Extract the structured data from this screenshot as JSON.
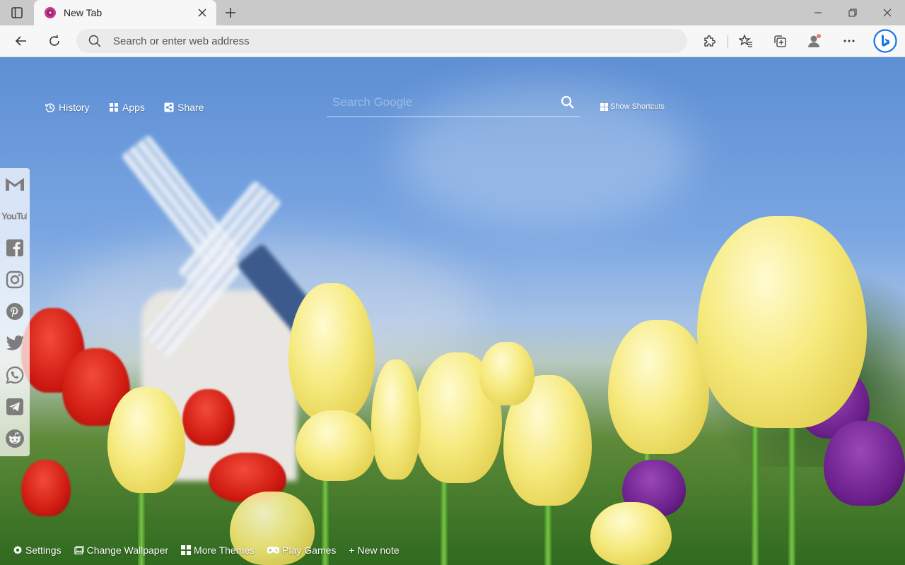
{
  "browser": {
    "tab_title": "New Tab",
    "address_placeholder": "Search or enter web address"
  },
  "newtab": {
    "links": {
      "history": "History",
      "apps": "Apps",
      "share": "Share"
    },
    "search_placeholder": "Search Google",
    "show_shortcuts": "Show Shortcuts",
    "social_icons": [
      "gmail-icon",
      "youtube-icon",
      "facebook-icon",
      "instagram-icon",
      "pinterest-icon",
      "twitter-icon",
      "whatsapp-icon",
      "telegram-icon",
      "reddit-icon"
    ],
    "youtube_logo_text": "YouTube",
    "bottom": {
      "settings": "Settings",
      "change_wallpaper": "Change Wallpaper",
      "more_themes": "More Themes",
      "play_games": "Play Games",
      "new_note": "+ New note"
    }
  },
  "colors": {
    "chrome_bg": "#f7f7f7",
    "tabbar_bg": "#c9c9c9",
    "bing_blue": "#1a73e8",
    "sky": "#7aa6e2"
  }
}
